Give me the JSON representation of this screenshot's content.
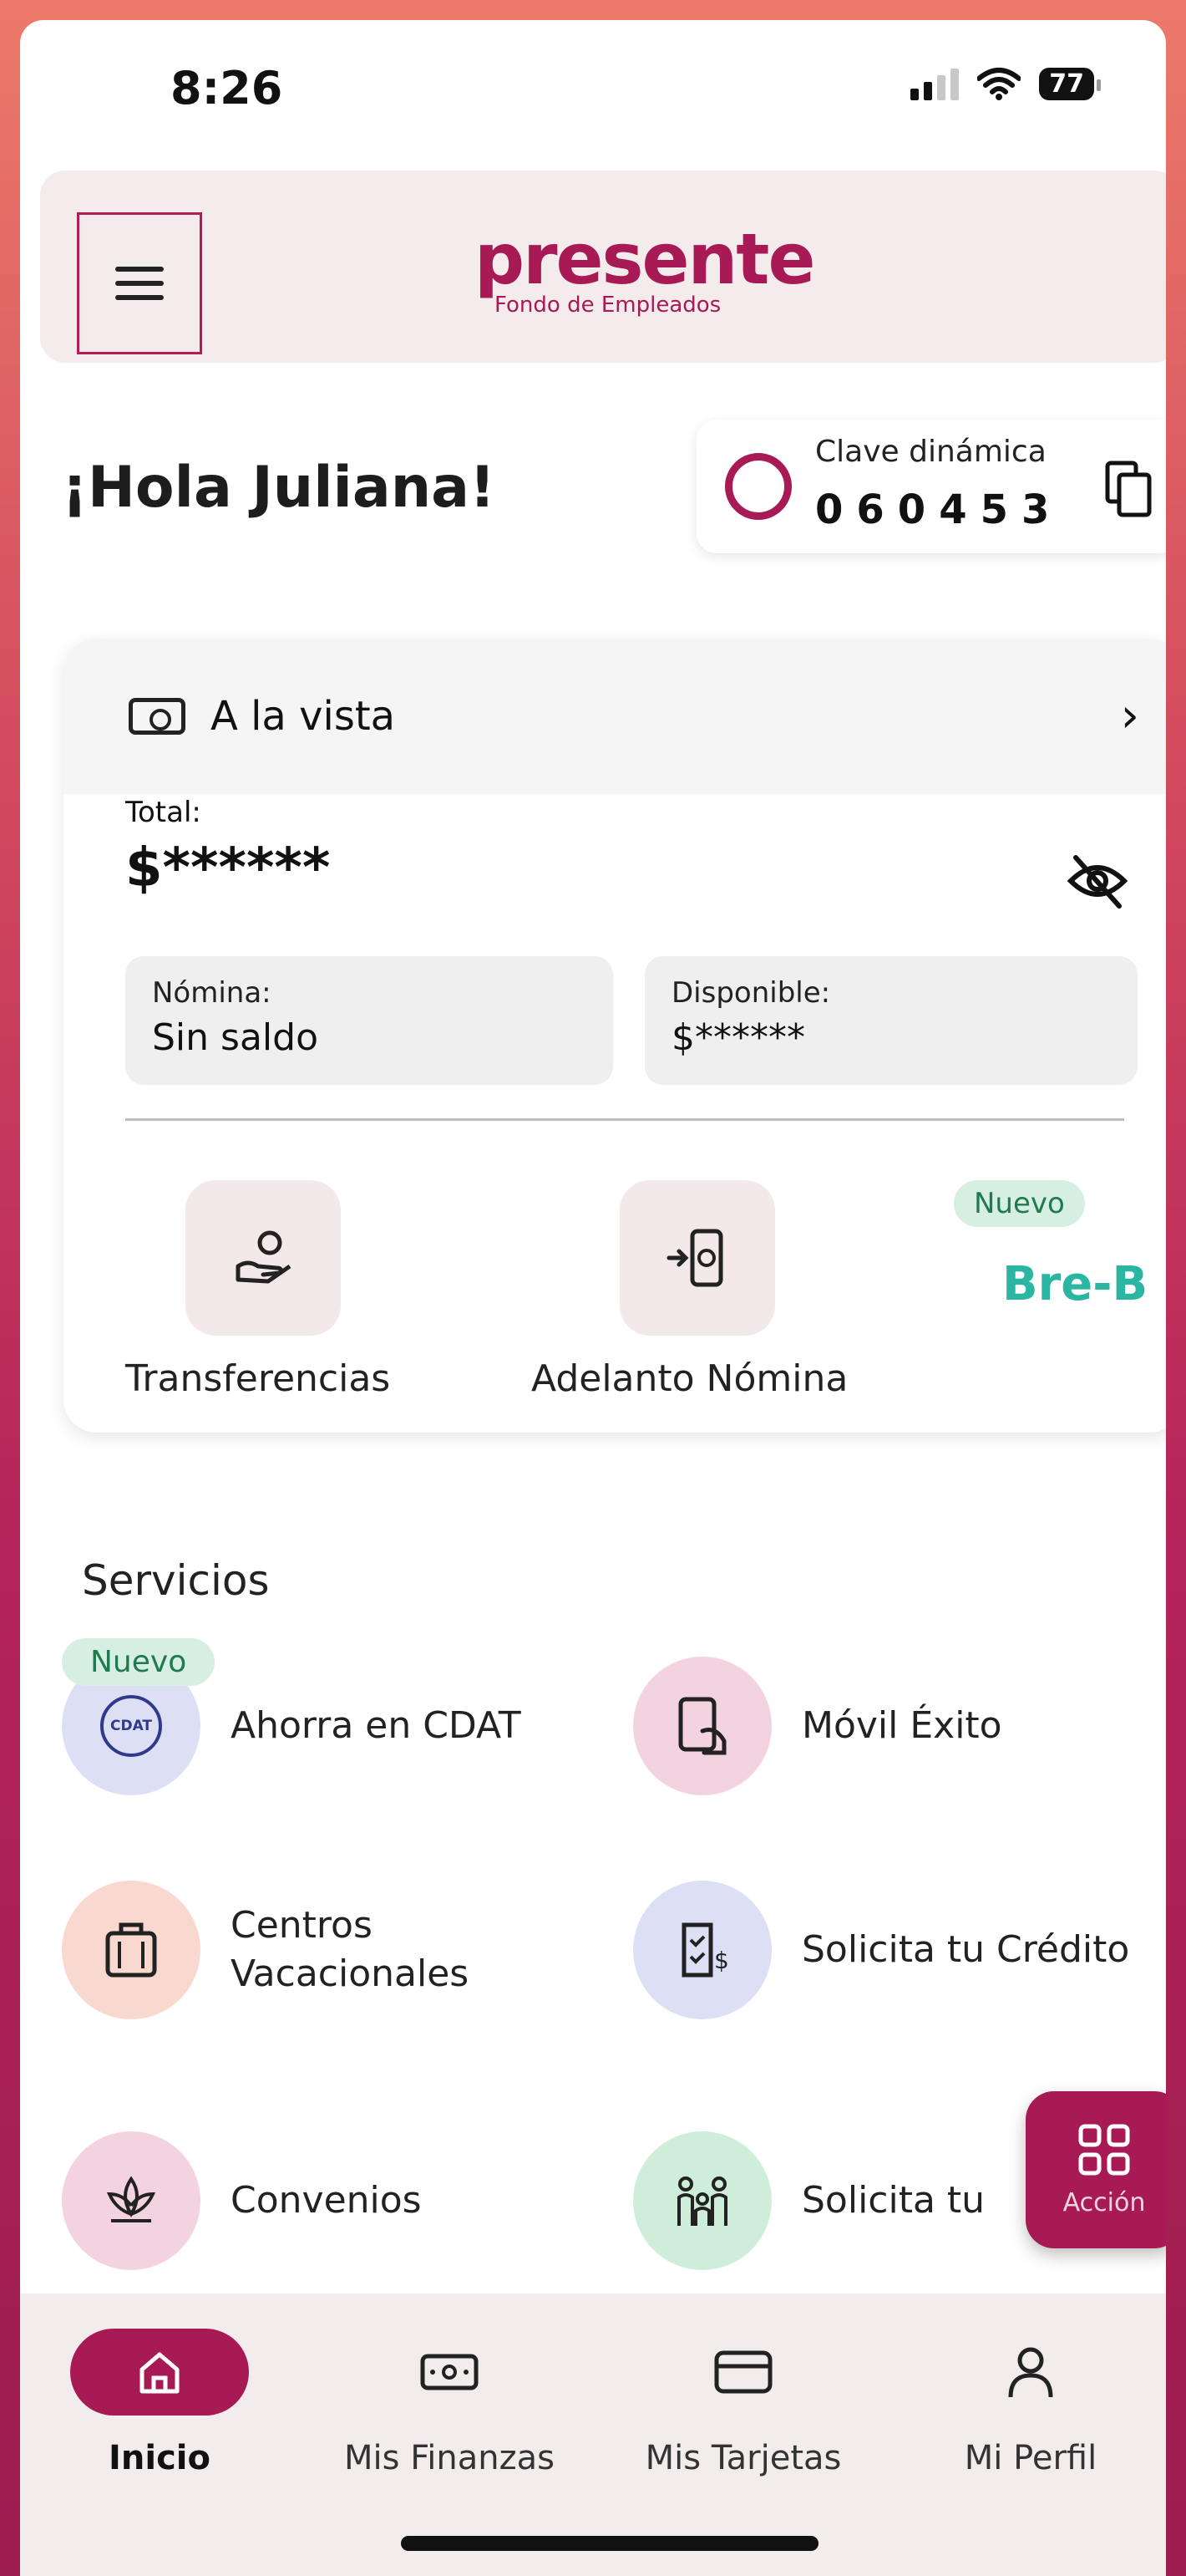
{
  "status_bar": {
    "time": "8:26",
    "battery": "77"
  },
  "header": {
    "brand": "presente",
    "brand_sub": "Fondo de Empleados"
  },
  "greeting": "¡Hola Juliana!",
  "otp": {
    "label": "Clave dinámica",
    "code": "060453"
  },
  "account": {
    "title": "A la vista",
    "total_label": "Total:",
    "total_value": "$******",
    "nomina_label": "Nómina:",
    "nomina_value": "Sin saldo",
    "disponible_label": "Disponible:",
    "disponible_value": "$******"
  },
  "quick_actions": {
    "transfer_label": "Transferencias",
    "advance_label": "Adelanto Nómina",
    "new_badge": "Nuevo",
    "breb_label": "Bre-B"
  },
  "services": {
    "title": "Servicios",
    "new_badge": "Nuevo",
    "cdat_icon_text": "CDAT",
    "items": [
      {
        "label": "Ahorra en CDAT",
        "icon": "cdat-icon",
        "color": "#dde0f5"
      },
      {
        "label": "Móvil Éxito",
        "icon": "phone-hand-icon",
        "color": "#f3d3df"
      },
      {
        "label": "Centros\nVacacionales",
        "icon": "luggage-icon",
        "color": "#f9d9cf"
      },
      {
        "label": "Solicita tu Crédito",
        "icon": "credit-icon",
        "color": "#dde0f5"
      },
      {
        "label": "Convenios",
        "icon": "lotus-icon",
        "color": "#f3d3df"
      },
      {
        "label": "Solicita tu",
        "icon": "family-icon",
        "color": "#cfeed9"
      }
    ]
  },
  "fab": {
    "label": "Acción"
  },
  "bottom_nav": {
    "items": [
      {
        "label": "Inicio",
        "icon": "home-icon"
      },
      {
        "label": "Mis Finanzas",
        "icon": "money-icon"
      },
      {
        "label": "Mis Tarjetas",
        "icon": "card-icon"
      },
      {
        "label": "Mi Perfil",
        "icon": "profile-icon"
      }
    ]
  },
  "colors": {
    "brand": "#a81a55",
    "teal": "#2bb6a3"
  }
}
